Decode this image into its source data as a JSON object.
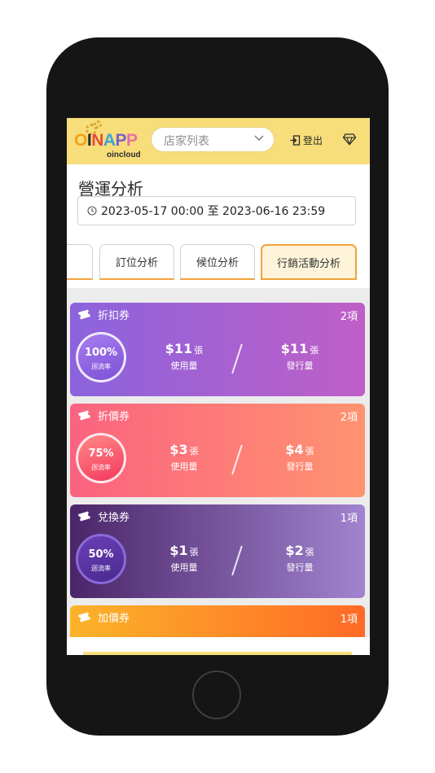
{
  "header": {
    "logo_text": "OINAPP",
    "logo_sub": "oincloud",
    "store_select": {
      "value": "店家列表"
    },
    "logout_label": "登出"
  },
  "page": {
    "title": "營運分析",
    "date_range": "2023-05-17 00:00 至 2023-06-16 23:59"
  },
  "tabs": [
    {
      "label": ""
    },
    {
      "label": "訂位分析"
    },
    {
      "label": "候位分析"
    },
    {
      "label": "行銷活動分析",
      "active": true
    }
  ],
  "coupons": [
    {
      "name": "折扣券",
      "count": "2項",
      "rate": "100%",
      "rate_label": "迴流率",
      "used_value": "$11",
      "used_unit": "張",
      "used_label": "使用量",
      "issued_value": "$11",
      "issued_unit": "張",
      "issued_label": "發行量",
      "gradient": [
        "#8b63dc",
        "#bf5fc7"
      ]
    },
    {
      "name": "折價券",
      "count": "2項",
      "rate": "75%",
      "rate_label": "迴流率",
      "used_value": "$3",
      "used_unit": "張",
      "used_label": "使用量",
      "issued_value": "$4",
      "issued_unit": "張",
      "issued_label": "發行量",
      "gradient": [
        "#fb6380",
        "#ff9370"
      ]
    },
    {
      "name": "兌換券",
      "count": "1項",
      "rate": "50%",
      "rate_label": "迴流率",
      "used_value": "$1",
      "used_unit": "張",
      "used_label": "使用量",
      "issued_value": "$2",
      "issued_unit": "張",
      "issued_label": "發行量",
      "gradient": [
        "#4b2569",
        "#a183cf"
      ]
    },
    {
      "name": "加價券",
      "count": "1項",
      "gradient": [
        "#fbb329",
        "#ff6a26"
      ]
    }
  ],
  "colors": {
    "header_bg": "#f7de7a",
    "tab_accent": "#f2a33b"
  }
}
